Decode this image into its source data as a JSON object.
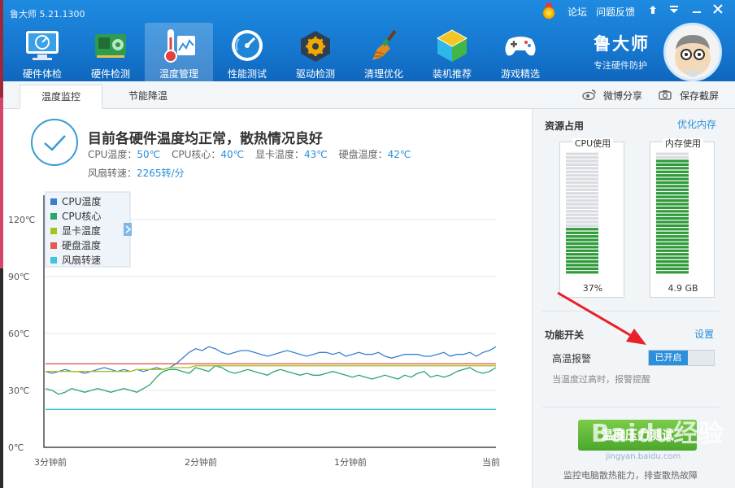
{
  "app": {
    "title": "鲁大师 5.21.1300"
  },
  "window_controls": {
    "forum_label": "论坛",
    "feedback_label": "问题反馈"
  },
  "nav": {
    "items": [
      {
        "label": "硬件体检",
        "icon": "monitor-icon"
      },
      {
        "label": "硬件检测",
        "icon": "hardware-board-icon"
      },
      {
        "label": "温度管理",
        "icon": "thermometer-icon",
        "active": true
      },
      {
        "label": "性能测试",
        "icon": "speedometer-icon"
      },
      {
        "label": "驱动检测",
        "icon": "gear-box-icon"
      },
      {
        "label": "清理优化",
        "icon": "broom-icon"
      },
      {
        "label": "装机推荐",
        "icon": "cube-icon"
      },
      {
        "label": "游戏精选",
        "icon": "gamepad-icon"
      }
    ]
  },
  "brand": {
    "name": "鲁大师",
    "slogan": "专注硬件防护"
  },
  "tabs": [
    {
      "label": "温度监控",
      "active": true
    },
    {
      "label": "节能降温",
      "active": false
    }
  ],
  "toolbar": {
    "share_label": "微博分享",
    "screenshot_label": "保存截屏"
  },
  "status": {
    "headline": "目前各硬件温度均正常，散热情况良好",
    "cpu_temp_label": "CPU温度：",
    "cpu_temp_value": "50℃",
    "cpu_core_label": "CPU核心：",
    "cpu_core_value": "40℃",
    "gpu_temp_label": "显卡温度：",
    "gpu_temp_value": "43℃",
    "disk_temp_label": "硬盘温度：",
    "disk_temp_value": "42℃",
    "fan_label": "风扇转速：",
    "fan_value": "2265转/分"
  },
  "chart_data": {
    "type": "line",
    "yticks": [
      "120℃",
      "90℃",
      "60℃",
      "30℃",
      "0℃"
    ],
    "xticks": [
      "3分钟前",
      "2分钟前",
      "1分钟前",
      "当前"
    ],
    "ylim": [
      0,
      120
    ],
    "legend_position": "top-left",
    "series": [
      {
        "name": "CPU温度",
        "color": "#3a7fd0",
        "values": [
          40,
          39,
          40,
          41,
          40,
          40,
          39,
          40,
          41,
          42,
          41,
          40,
          41,
          40,
          41,
          40,
          41,
          42,
          41,
          42,
          44,
          47,
          50,
          52,
          51,
          53,
          52,
          50,
          49,
          50,
          51,
          51,
          50,
          49,
          48,
          49,
          50,
          51,
          50,
          49,
          48,
          49,
          50,
          50,
          49,
          50,
          48,
          49,
          50,
          49,
          49,
          50,
          48,
          47,
          48,
          49,
          49,
          49,
          48,
          48,
          49,
          50,
          48,
          49,
          49,
          50,
          48,
          50,
          51,
          53
        ]
      },
      {
        "name": "CPU核心",
        "color": "#2aa66a",
        "values": [
          31,
          30,
          28,
          29,
          31,
          30,
          29,
          30,
          31,
          30,
          29,
          30,
          31,
          30,
          29,
          31,
          33,
          37,
          40,
          41,
          41,
          40,
          39,
          42,
          41,
          40,
          43,
          42,
          40,
          39,
          40,
          41,
          40,
          39,
          38,
          40,
          41,
          40,
          39,
          38,
          39,
          38,
          38,
          39,
          40,
          39,
          38,
          37,
          38,
          37,
          36,
          37,
          38,
          37,
          36,
          38,
          37,
          39,
          40,
          37,
          38,
          37,
          38,
          40,
          41,
          42,
          40,
          39,
          40,
          42
        ]
      },
      {
        "name": "显卡温度",
        "color": "#a8c21a",
        "values": [
          40,
          40,
          40,
          40,
          40,
          40,
          40,
          40,
          40,
          40,
          40,
          40,
          40,
          40,
          41,
          41,
          41,
          41,
          41,
          42,
          42,
          42,
          42,
          43,
          43,
          43,
          43,
          43,
          43,
          43,
          43,
          43,
          43,
          43,
          43,
          43,
          43,
          43,
          43,
          43,
          43,
          43,
          43,
          43,
          43,
          43,
          43,
          43,
          43,
          43,
          43,
          43,
          43,
          43,
          43,
          43,
          43,
          43,
          43,
          43,
          43,
          43,
          43,
          43,
          43,
          43,
          43,
          43,
          43,
          43
        ]
      },
      {
        "name": "硬盘温度",
        "color": "#e05a5a",
        "values": [
          44,
          44,
          44,
          44,
          44,
          44,
          44,
          44,
          44,
          44,
          44,
          44,
          44,
          44,
          44,
          44,
          44,
          44,
          44,
          44,
          44,
          44,
          44,
          44,
          44,
          44,
          44,
          44,
          44,
          44,
          44,
          44,
          44,
          44,
          44,
          44,
          44,
          44,
          44,
          44,
          44,
          44,
          44,
          44,
          44,
          44,
          44,
          44,
          44,
          44,
          44,
          44,
          44,
          44,
          44,
          44,
          44,
          44,
          44,
          44,
          44,
          44,
          44,
          44,
          44,
          44,
          44,
          44,
          44,
          44
        ]
      },
      {
        "name": "风扇转速",
        "color": "#3cc6d8",
        "values": [
          20,
          20,
          20,
          20,
          20,
          20,
          20,
          20,
          20,
          20,
          20,
          20,
          20,
          20,
          20,
          20,
          20,
          20,
          20,
          20,
          20,
          20,
          20,
          20,
          20,
          20,
          20,
          20,
          20,
          20,
          20,
          20,
          20,
          20,
          20,
          20,
          20,
          20,
          20,
          20,
          20,
          20,
          20,
          20,
          20,
          20,
          20,
          20,
          20,
          20,
          20,
          20,
          20,
          20,
          20,
          20,
          20,
          20,
          20,
          20,
          20,
          20,
          20,
          20,
          20,
          20,
          20,
          20,
          20,
          20
        ]
      }
    ]
  },
  "resources": {
    "title": "资源占用",
    "optimize_link": "优化内存",
    "cpu": {
      "label": "CPU使用",
      "value": "37%",
      "fill": 0.37
    },
    "memory": {
      "label": "内存使用",
      "value": "4.9 GB",
      "fill": 0.93
    }
  },
  "features": {
    "title": "功能开关",
    "settings_link": "设置",
    "high_temp_label": "高温报警",
    "toggle_label": "已开启",
    "hint": "当温度过高时，报警提醒"
  },
  "pressure_test": {
    "button_label": "温度压力测试",
    "footer": "监控电脑散热能力，排查散热故障"
  },
  "watermark": {
    "text": "Baidu经验",
    "sub": "jingyan.baidu.com"
  },
  "colors": {
    "accent": "#1677cf",
    "toggle_on": "#2c8fdc",
    "meter_green": "#2e9a3a",
    "button_green": "#5ab535"
  }
}
